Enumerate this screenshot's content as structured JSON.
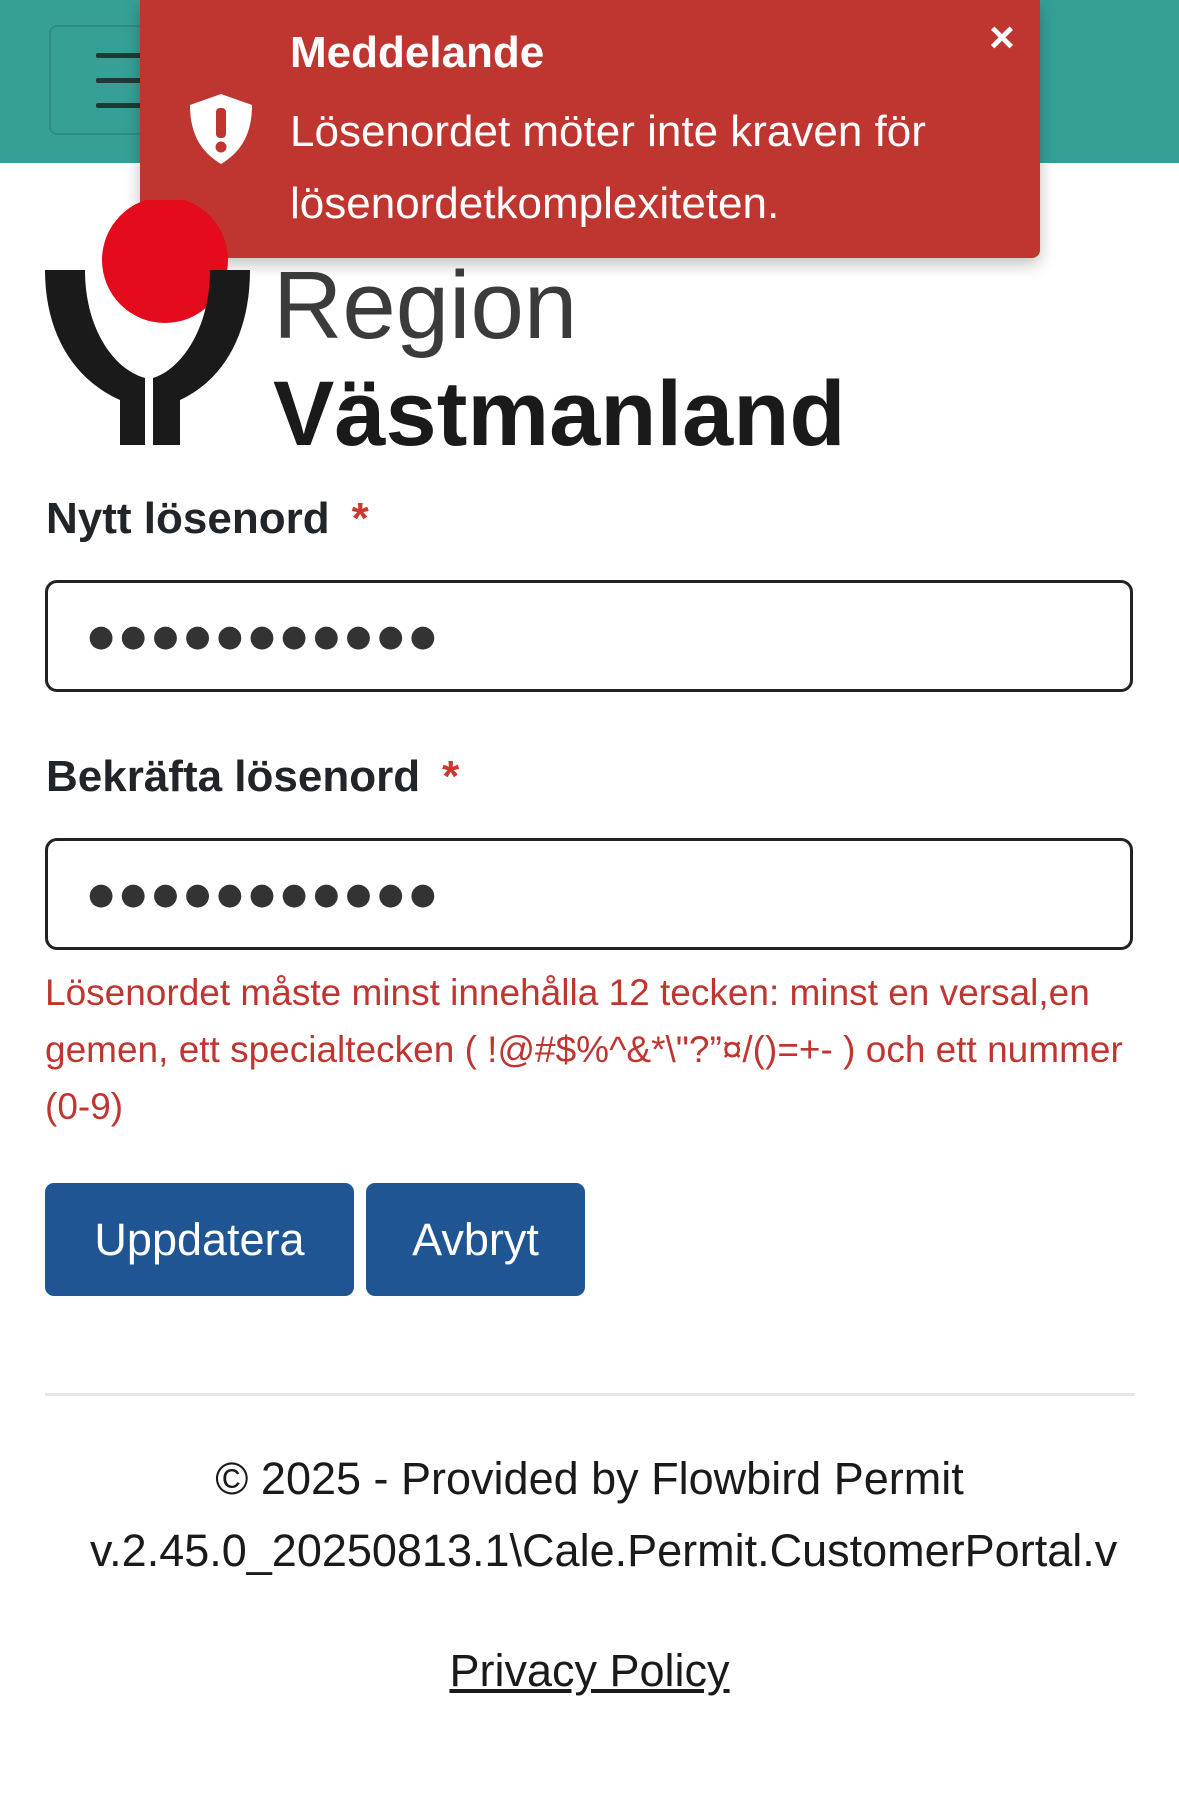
{
  "header": {
    "menu_icon": "hamburger-menu-icon",
    "background_color": "#36a096"
  },
  "toast": {
    "title": "Meddelande",
    "message": "Lösenordet möter inte kraven för lösenordetkomplexiteten.",
    "icon": "shield-exclamation-icon",
    "close_label": "×",
    "background_color": "#bf3631"
  },
  "logo": {
    "line1": "Region",
    "line2": "Västmanland"
  },
  "form": {
    "new_password_label": "Nytt lösenord",
    "new_password_value": "●●●●●●●●●●●",
    "confirm_password_label": "Bekräfta lösenord",
    "confirm_password_value": "●●●●●●●●●●●",
    "required_marker": "*",
    "validation_message": "Lösenordet måste minst innehålla 12 tecken: minst en versal,en gemen, ett specialtecken ( !@#$%^&*\\\"?”¤/()=+- ) och ett nummer (0-9)",
    "update_button": "Uppdatera",
    "cancel_button": "Avbryt",
    "button_color": "#1f5593"
  },
  "footer": {
    "copyright": "© 2025 - Provided by Flowbird Permit",
    "version": "v.2.45.0_20250813.1\\Cale.Permit.CustomerPortal.v",
    "privacy_link": "Privacy Policy"
  }
}
